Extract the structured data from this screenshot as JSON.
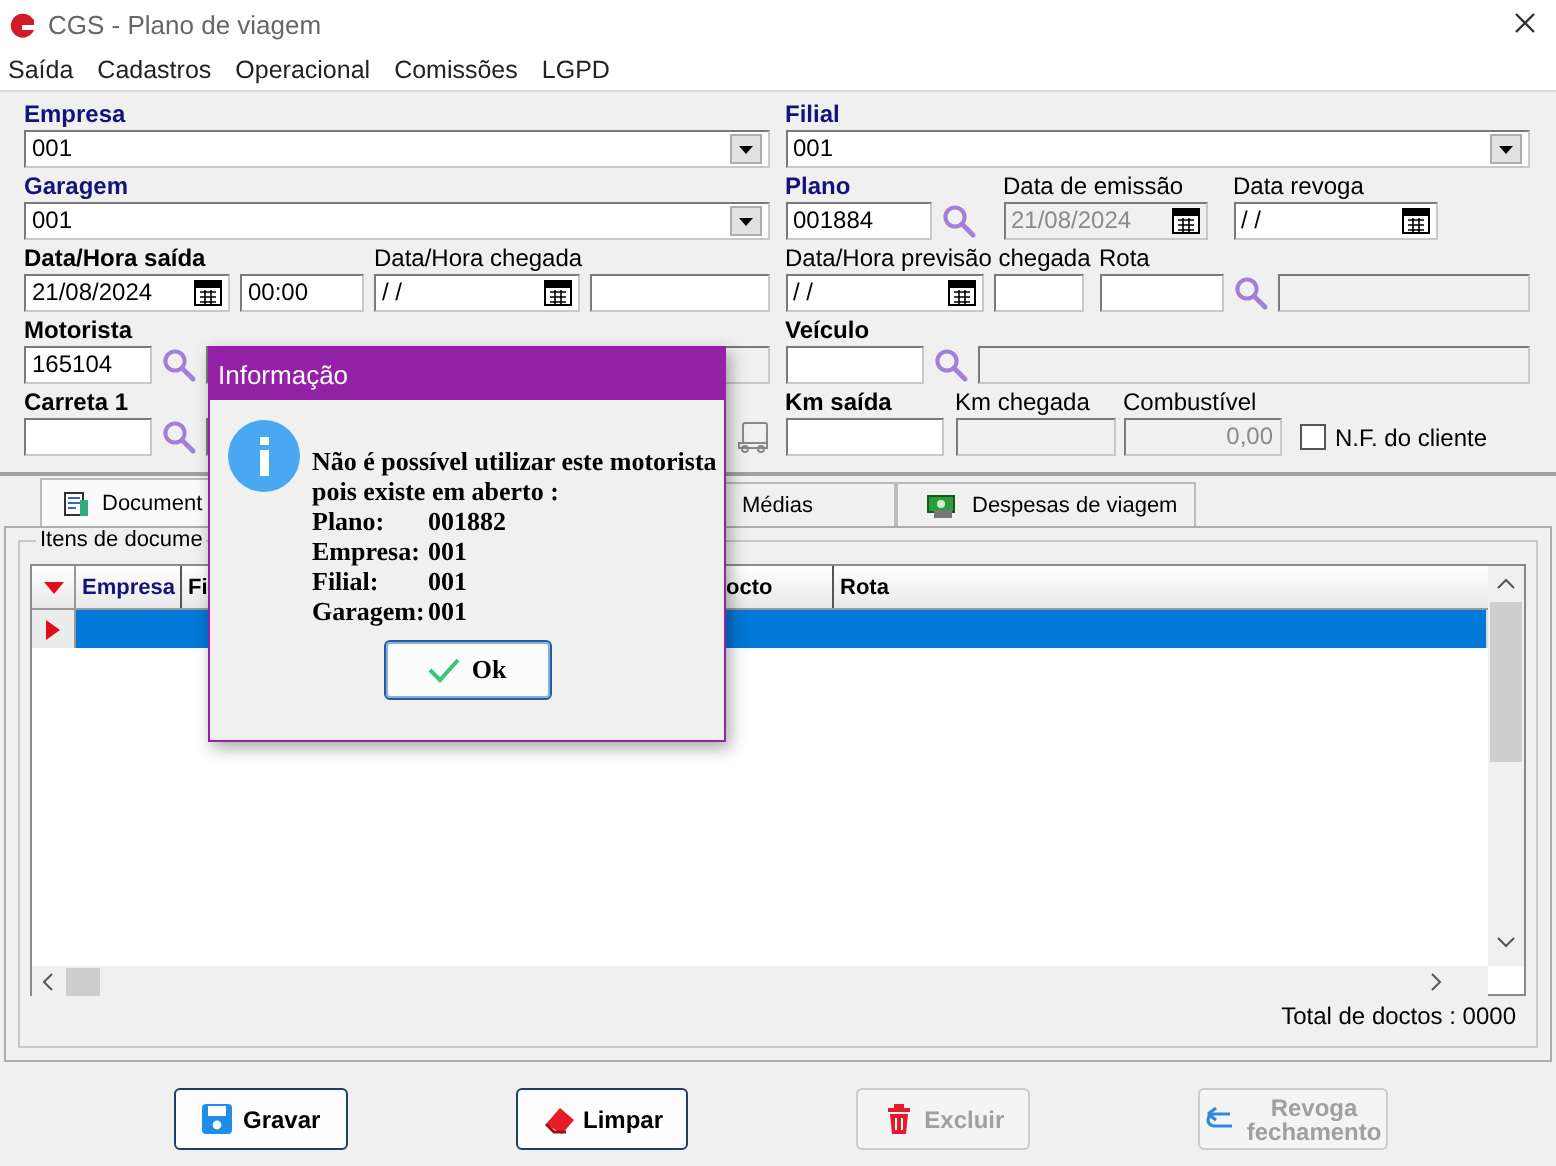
{
  "window": {
    "title": "CGS - Plano de viagem"
  },
  "menu": [
    "Saída",
    "Cadastros",
    "Operacional",
    "Comissões",
    "LGPD"
  ],
  "form": {
    "left": [
      {
        "groups": [
          {
            "label": "Empresa",
            "kind": "key",
            "controls": [
              {
                "kind": "select",
                "value": "001"
              }
            ]
          }
        ]
      },
      {
        "groups": [
          {
            "label": "Garagem",
            "kind": "key",
            "controls": [
              {
                "kind": "select",
                "value": "001"
              }
            ]
          }
        ]
      },
      {
        "groups": [
          {
            "label": "Data/Hora saída",
            "kind": "strong",
            "controls": [
              {
                "kind": "date",
                "value": "21/08/2024",
                "disabled": false
              },
              {
                "kind": "text",
                "value": "00:00",
                "disabled": false
              }
            ]
          },
          {
            "label": "Data/Hora chegada",
            "kind": "normal",
            "controls": [
              {
                "kind": "date",
                "value": " / /",
                "disabled": false
              },
              {
                "kind": "text",
                "disabled": false
              }
            ]
          }
        ]
      },
      {
        "groups": [
          {
            "label": "Motorista",
            "kind": "strong",
            "controls": [
              {
                "kind": "text",
                "value": "165104",
                "disabled": false
              },
              {
                "kind": "search"
              },
              {
                "kind": "text",
                "disabled": true
              }
            ]
          }
        ]
      },
      {
        "groups": [
          {
            "label": "Carreta 1",
            "kind": "strong",
            "controls": [
              {
                "kind": "text",
                "disabled": false
              },
              {
                "kind": "search"
              },
              {
                "kind": "text"
              },
              {
                "kind": "truck"
              }
            ]
          }
        ]
      }
    ],
    "right": [
      {
        "groups": [
          {
            "label": "Filial",
            "kind": "key",
            "controls": [
              {
                "kind": "select",
                "value": "001"
              }
            ]
          }
        ]
      },
      {
        "groups": [
          {
            "label": "Plano",
            "kind": "key",
            "controls": [
              {
                "kind": "text",
                "value": "001884",
                "disabled": false
              },
              {
                "kind": "search"
              }
            ]
          },
          {
            "label": "Data de emissão",
            "kind": "normal",
            "controls": [
              {
                "kind": "date",
                "value": "21/08/2024",
                "disabled": true
              }
            ]
          },
          {
            "label": "Data revoga",
            "kind": "normal",
            "controls": [
              {
                "kind": "date",
                "value": " / /",
                "disabled": false
              }
            ]
          }
        ]
      },
      {
        "groups": [
          {
            "label": "Data/Hora previsão chegada",
            "kind": "normal",
            "controls": [
              {
                "kind": "date",
                "value": " / /",
                "disabled": false
              },
              {
                "kind": "text",
                "disabled": false
              }
            ]
          },
          {
            "label": "Rota",
            "kind": "normal",
            "controls": [
              {
                "kind": "text",
                "disabled": false
              },
              {
                "kind": "search"
              },
              {
                "kind": "text",
                "disabled": true
              }
            ]
          }
        ]
      },
      {
        "groups": [
          {
            "label": "Veículo",
            "kind": "strong",
            "controls": [
              {
                "kind": "text",
                "disabled": false
              },
              {
                "kind": "search"
              },
              {
                "kind": "text",
                "disabled": true
              }
            ]
          }
        ]
      },
      {
        "groups": [
          {
            "label": "Km saída",
            "kind": "strong",
            "controls": [
              {
                "kind": "text",
                "disabled": false
              }
            ]
          },
          {
            "label": "Km chegada",
            "kind": "normal",
            "controls": [
              {
                "kind": "text",
                "disabled": true
              }
            ]
          },
          {
            "label": "Combustível",
            "kind": "normal",
            "controls": [
              {
                "kind": "number",
                "value": "0,00",
                "disabled": true
              },
              {
                "kind": "checkbox",
                "label": "N.F. do cliente",
                "checked": false
              }
            ]
          }
        ]
      }
    ]
  },
  "tabs": [
    {
      "label": "Document",
      "selected": true
    },
    {
      "label": "Médias",
      "selected": false
    },
    {
      "label": "Despesas de viagem",
      "selected": false
    }
  ],
  "grid": {
    "group_label": "Itens de docume",
    "columns": [
      "Empresa",
      "Fi",
      "octo",
      "Rota"
    ],
    "rows": [
      {
        "selected": true
      }
    ],
    "footer": "Total de doctos : 0000"
  },
  "buttons": [
    {
      "label": "Gravar",
      "disabled": false
    },
    {
      "label": "Limpar",
      "disabled": false
    },
    {
      "label": "Excluir",
      "disabled": true
    },
    {
      "label": "Revoga fechamento",
      "disabled": true
    }
  ],
  "dialog": {
    "title": "Informação",
    "message": "Não é possível utilizar este motorista\npois existe em aberto :",
    "details": [
      {
        "label": "Plano:",
        "value": "001882"
      },
      {
        "label": "Empresa:",
        "value": "001"
      },
      {
        "label": "Filial:",
        "value": "001"
      },
      {
        "label": "Garagem:",
        "value": "001"
      }
    ],
    "button": "Ok"
  }
}
